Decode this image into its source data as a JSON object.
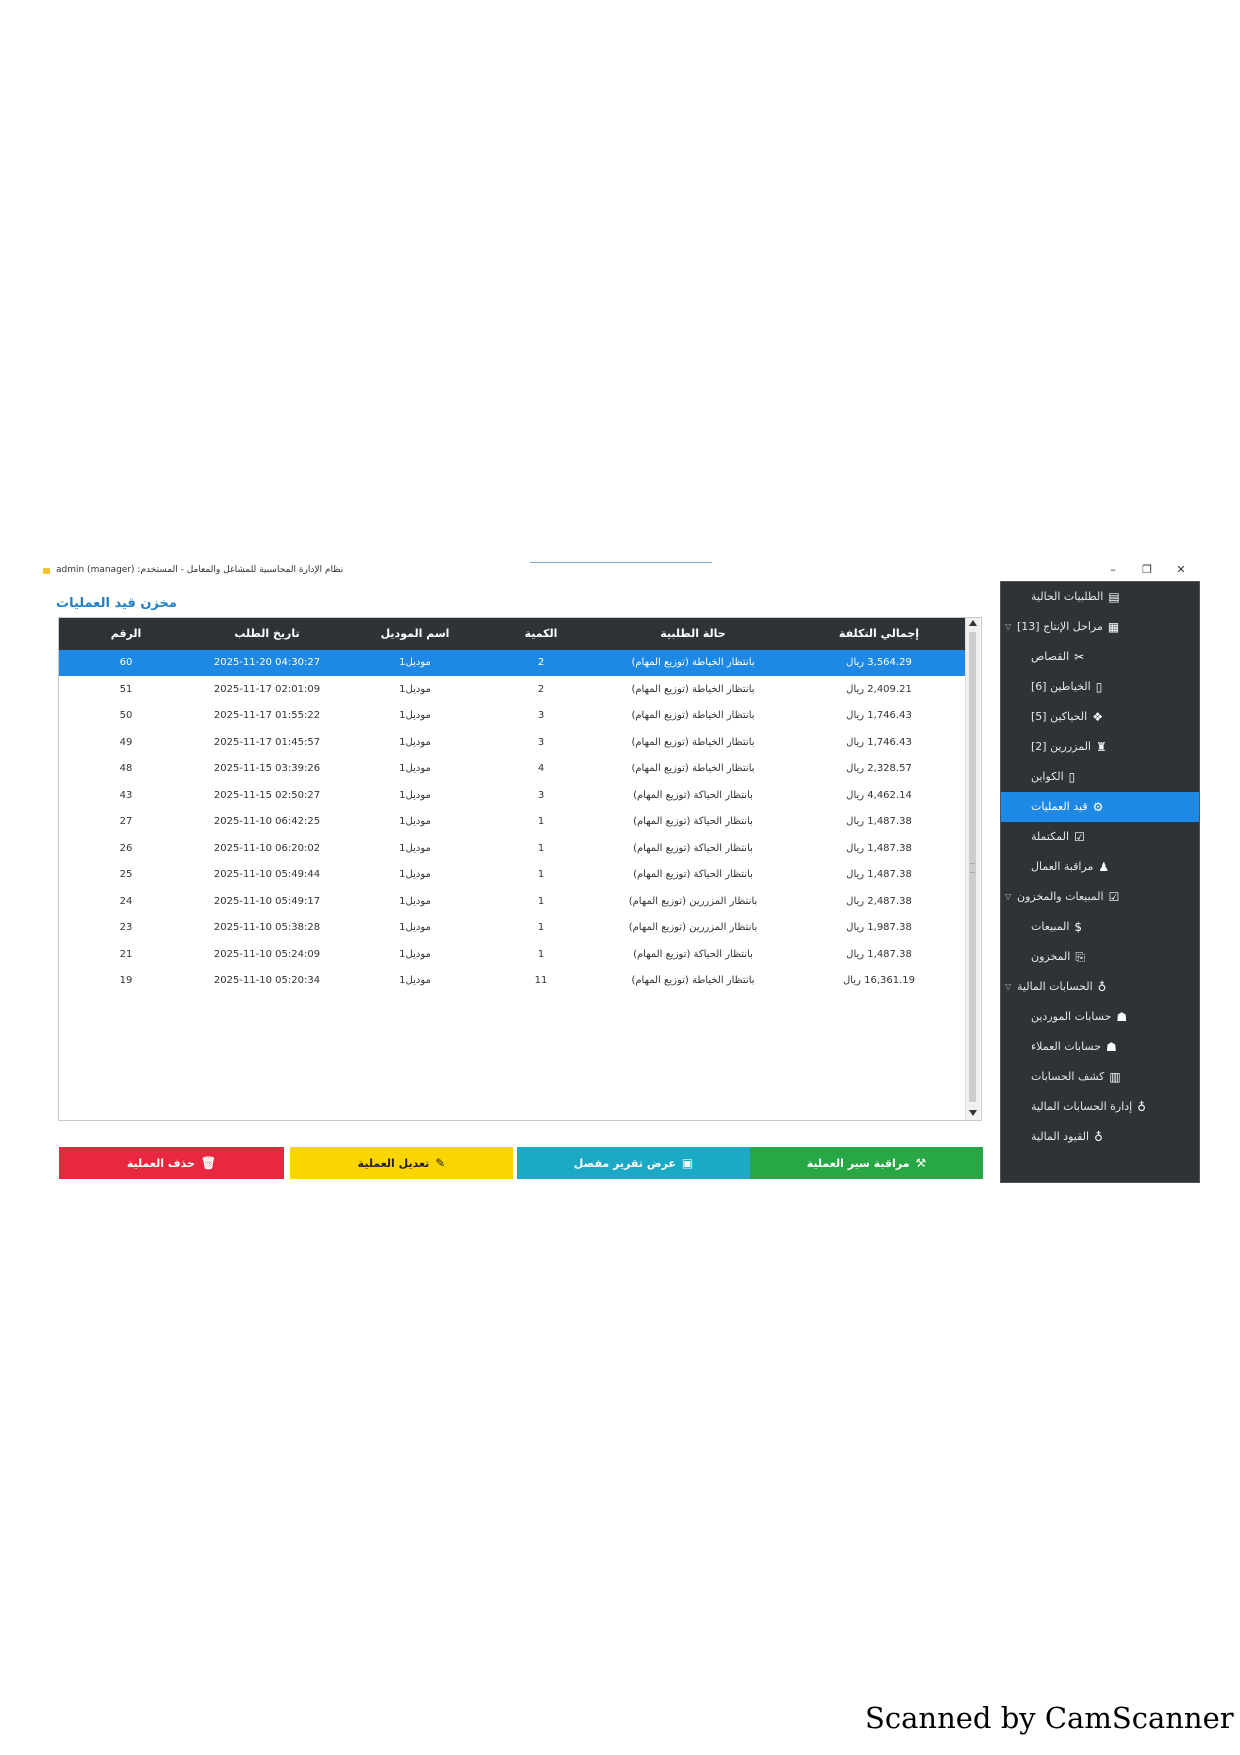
{
  "window": {
    "title": "نظام الإدارة المحاسبية للمشاغل والمعامل - المستخدم: admin (manager)",
    "controls": {
      "minimize": "–",
      "maximize": "❐",
      "close": "✕"
    }
  },
  "panel": {
    "title": "مخزن قيد العمليات"
  },
  "table": {
    "columns": [
      "إجمالي التكلفة",
      "حالة الطلبية",
      "الكمية",
      "اسم الموديل",
      "تاريخ الطلب",
      "الرقم"
    ],
    "selected_row": 0,
    "rows": [
      {
        "cost": "3,564.29 ريال",
        "status": "بانتظار الخياطة (توزيع المهام)",
        "qty": "2",
        "model": "موديل1",
        "date": "2025-11-20 04:30:27",
        "id": "60"
      },
      {
        "cost": "2,409.21 ريال",
        "status": "بانتظار الخياطة (توزيع المهام)",
        "qty": "2",
        "model": "موديل1",
        "date": "2025-11-17 02:01:09",
        "id": "51"
      },
      {
        "cost": "1,746.43 ريال",
        "status": "بانتظار الخياطة (توزيع المهام)",
        "qty": "3",
        "model": "موديل1",
        "date": "2025-11-17 01:55:22",
        "id": "50"
      },
      {
        "cost": "1,746.43 ريال",
        "status": "بانتظار الخياطة (توزيع المهام)",
        "qty": "3",
        "model": "موديل1",
        "date": "2025-11-17 01:45:57",
        "id": "49"
      },
      {
        "cost": "2,328.57 ريال",
        "status": "بانتظار الخياطة (توزيع المهام)",
        "qty": "4",
        "model": "موديل1",
        "date": "2025-11-15 03:39:26",
        "id": "48"
      },
      {
        "cost": "4,462.14 ريال",
        "status": "بانتظار الحياكة (توزيع المهام)",
        "qty": "3",
        "model": "موديل1",
        "date": "2025-11-15 02:50:27",
        "id": "43"
      },
      {
        "cost": "1,487.38 ريال",
        "status": "بانتظار الحياكة (توزيع المهام)",
        "qty": "1",
        "model": "موديل1",
        "date": "2025-11-10 06:42:25",
        "id": "27"
      },
      {
        "cost": "1,487.38 ريال",
        "status": "بانتظار الحياكة (توزيع المهام)",
        "qty": "1",
        "model": "موديل1",
        "date": "2025-11-10 06:20:02",
        "id": "26"
      },
      {
        "cost": "1,487.38 ريال",
        "status": "بانتظار الحياكة (توزيع المهام)",
        "qty": "1",
        "model": "موديل1",
        "date": "2025-11-10 05:49:44",
        "id": "25"
      },
      {
        "cost": "2,487.38 ريال",
        "status": "بانتظار المزررين (توزيع المهام)",
        "qty": "1",
        "model": "موديل1",
        "date": "2025-11-10 05:49:17",
        "id": "24"
      },
      {
        "cost": "1,987.38 ريال",
        "status": "بانتظار المزررين (توزيع المهام)",
        "qty": "1",
        "model": "موديل1",
        "date": "2025-11-10 05:38:28",
        "id": "23"
      },
      {
        "cost": "1,487.38 ريال",
        "status": "بانتظار الحياكة (توزيع المهام)",
        "qty": "1",
        "model": "موديل1",
        "date": "2025-11-10 05:24:09",
        "id": "21"
      },
      {
        "cost": "16,361.19 ريال",
        "status": "بانتظار الخياطة (توزيع المهام)",
        "qty": "11",
        "model": "موديل1",
        "date": "2025-11-10 05:20:34",
        "id": "19"
      }
    ]
  },
  "buttons": {
    "monitor": {
      "label": "مراقبة سير العملية",
      "icon": "⚒"
    },
    "report": {
      "label": "عرض تقرير مفصل",
      "icon": "▣"
    },
    "edit": {
      "label": "تعديل العملية",
      "icon": "✎"
    },
    "delete": {
      "label": "حذف العملية",
      "icon": "🗑"
    }
  },
  "sidebar": {
    "items": [
      {
        "label": "الطلبيات الحالية",
        "icon": "▤",
        "icon_name": "orders-icon",
        "indent": 1,
        "caret": ""
      },
      {
        "label": "مراحل الإنتاج [13]",
        "icon": "▦",
        "icon_name": "factory-icon",
        "indent": 0,
        "caret": "▽"
      },
      {
        "label": "القصاص",
        "icon": "✂",
        "icon_name": "scissors-icon",
        "indent": 1,
        "caret": ""
      },
      {
        "label": "الخياطين [6]",
        "icon": "▯",
        "icon_name": "tailor-icon",
        "indent": 1,
        "caret": ""
      },
      {
        "label": "الحياكين [5]",
        "icon": "❖",
        "icon_name": "weaver-icon",
        "indent": 1,
        "caret": ""
      },
      {
        "label": "المزررين [2]",
        "icon": "♜",
        "icon_name": "button-worker-icon",
        "indent": 1,
        "caret": ""
      },
      {
        "label": "الكواين",
        "icon": "▯",
        "icon_name": "ironing-icon",
        "indent": 1,
        "caret": ""
      },
      {
        "label": "قيد العمليات",
        "icon": "⚙",
        "icon_name": "gear-icon",
        "indent": 1,
        "caret": ""
      },
      {
        "label": "المكتملة",
        "icon": "☑",
        "icon_name": "check-icon",
        "indent": 1,
        "caret": ""
      },
      {
        "label": "مراقبة العمال",
        "icon": "♟",
        "icon_name": "worker-monitor-icon",
        "indent": 1,
        "caret": ""
      },
      {
        "label": "المبيعات والمخزون",
        "icon": "☑",
        "icon_name": "sales-inventory-icon",
        "indent": 0,
        "caret": "▽"
      },
      {
        "label": "المبيعات",
        "icon": "$",
        "icon_name": "dollar-icon",
        "indent": 1,
        "caret": ""
      },
      {
        "label": "المخزون",
        "icon": "⎘",
        "icon_name": "inventory-icon",
        "indent": 1,
        "caret": ""
      },
      {
        "label": "الحسابات المالية",
        "icon": "♁",
        "icon_name": "finance-icon",
        "indent": 0,
        "caret": "▽"
      },
      {
        "label": "حسابات الموردين",
        "icon": "☗",
        "icon_name": "suppliers-icon",
        "indent": 1,
        "caret": ""
      },
      {
        "label": "حسابات العملاء",
        "icon": "☗",
        "icon_name": "customers-icon",
        "indent": 1,
        "caret": ""
      },
      {
        "label": "كشف الحسابات",
        "icon": "▥",
        "icon_name": "statement-icon",
        "indent": 1,
        "caret": ""
      },
      {
        "label": "إدارة الحسابات المالية",
        "icon": "♁",
        "icon_name": "accounts-manage-icon",
        "indent": 1,
        "caret": ""
      },
      {
        "label": "القيود المالية",
        "icon": "♁",
        "icon_name": "journal-icon",
        "indent": 1,
        "caret": ""
      }
    ],
    "active_index": 7
  },
  "footer": {
    "scanned": "Scanned by CamScanner"
  }
}
